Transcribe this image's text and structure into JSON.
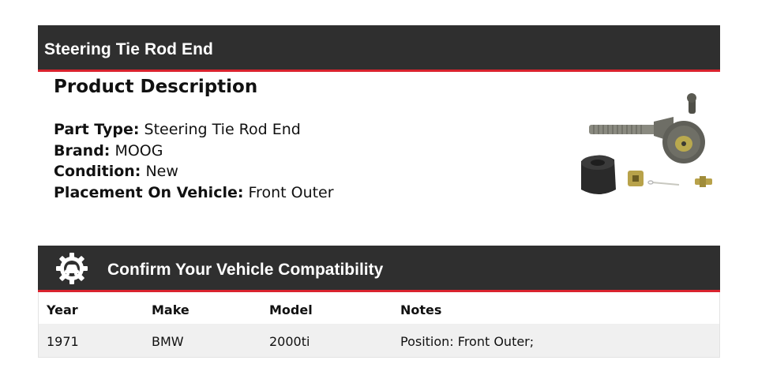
{
  "header": {
    "title": "Steering Tie Rod End"
  },
  "description": {
    "heading": "Product Description",
    "specs": [
      {
        "label": "Part Type:",
        "value": "Steering Tie Rod End"
      },
      {
        "label": "Brand:",
        "value": "MOOG"
      },
      {
        "label": "Condition:",
        "value": "New"
      },
      {
        "label": "Placement On Vehicle:",
        "value": "Front Outer"
      }
    ]
  },
  "compatibility": {
    "title": "Confirm Your Vehicle Compatibility",
    "icon": "gear-car-icon",
    "columns": [
      "Year",
      "Make",
      "Model",
      "Notes"
    ],
    "rows": [
      [
        "1971",
        "BMW",
        "2000ti",
        "Position: Front Outer;"
      ]
    ]
  },
  "colors": {
    "bar": "#2f2f2f",
    "accent": "#d9232e",
    "row": "#f0f0f0"
  }
}
